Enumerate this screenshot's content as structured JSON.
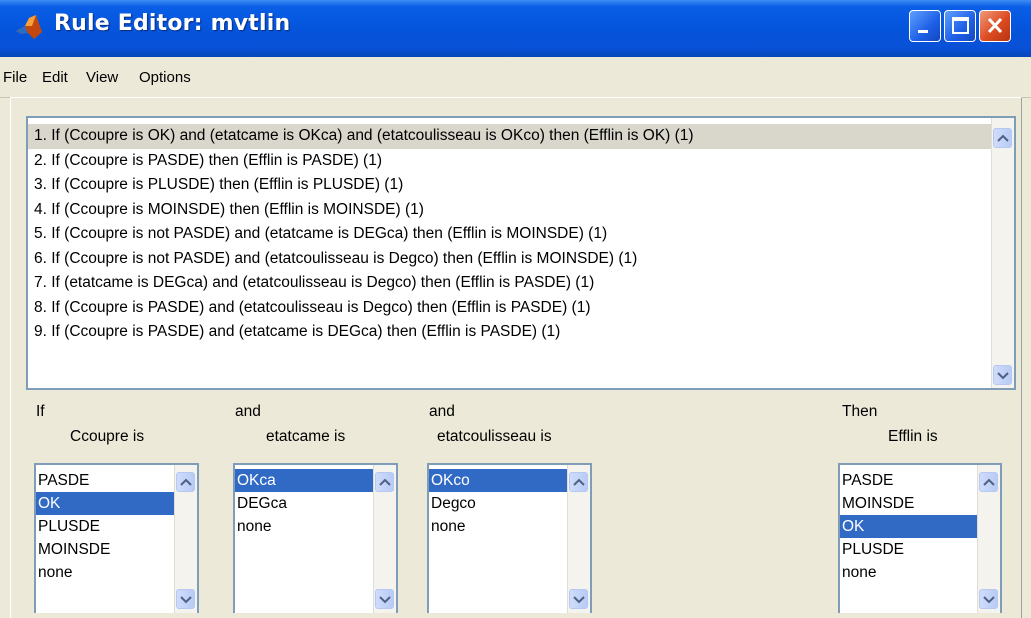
{
  "window": {
    "title": "Rule Editor: mvtlin"
  },
  "menu": [
    "File",
    "Edit",
    "View",
    "Options"
  ],
  "rules": [
    "1. If (Ccoupre is OK) and (etatcame is OKca) and (etatcoulisseau is OKco) then (Efflin is OK) (1)",
    "2. If (Ccoupre is PASDE) then (Efflin is PASDE) (1)",
    "3. If (Ccoupre is PLUSDE) then (Efflin is PLUSDE) (1)",
    "4. If (Ccoupre is MOINSDE) then (Efflin is MOINSDE) (1)",
    "5. If (Ccoupre is not PASDE) and (etatcame is DEGca) then (Efflin is MOINSDE) (1)",
    "6. If (Ccoupre is not PASDE) and (etatcoulisseau is Degco) then (Efflin is MOINSDE) (1)",
    "7. If (etatcame is DEGca) and (etatcoulisseau is Degco) then (Efflin is PASDE) (1)",
    "8. If (Ccoupre is PASDE) and (etatcoulisseau is Degco) then (Efflin is PASDE) (1)",
    "9. If (Ccoupre is PASDE) and (etatcame is DEGca) then (Efflin is PASDE) (1)"
  ],
  "selected_rule": 0,
  "columns": [
    {
      "connector": "If",
      "var_label": "Ccoupre is",
      "options": [
        "PASDE",
        "OK",
        "PLUSDE",
        "MOINSDE",
        "none"
      ],
      "selected": 1
    },
    {
      "connector": "and",
      "var_label": "etatcame is",
      "options": [
        "OKca",
        "DEGca",
        "none"
      ],
      "selected": 0
    },
    {
      "connector": "and",
      "var_label": "etatcoulisseau is",
      "options": [
        "OKco",
        "Degco",
        "none"
      ],
      "selected": 0
    },
    {
      "connector": "Then",
      "var_label": "Efflin is",
      "options": [
        "PASDE",
        "MOINSDE",
        "OK",
        "PLUSDE",
        "none"
      ],
      "selected": 2
    }
  ],
  "icons": [
    "matlab-logo-icon",
    "minimize-icon",
    "maximize-icon",
    "close-icon",
    "scroll-up-icon",
    "scroll-down-icon"
  ]
}
